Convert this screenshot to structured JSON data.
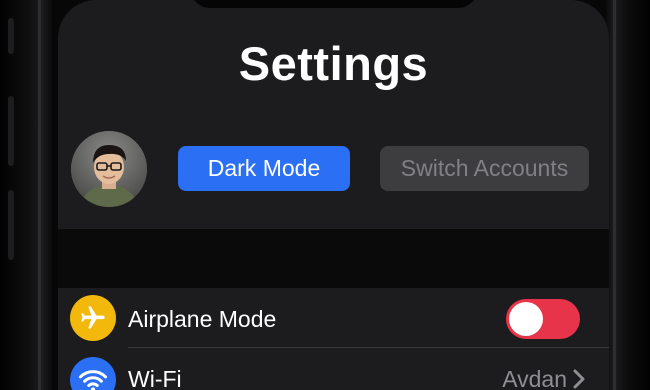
{
  "page": {
    "title": "Settings"
  },
  "profile": {
    "dark_mode_button": "Dark Mode",
    "switch_accounts_button": "Switch Accounts"
  },
  "settings": {
    "items": [
      {
        "label": "Airplane Mode",
        "icon": "airplane-icon",
        "icon_color": "#f2b90c",
        "control": "toggle",
        "toggle_on": true
      },
      {
        "label": "Wi-Fi",
        "icon": "wifi-icon",
        "icon_color": "#2b6ff4",
        "control": "disclosure",
        "detail": "Avdan"
      }
    ]
  },
  "colors": {
    "accent": "#2b6ff4",
    "toggle_on": "#e8344a",
    "background": "#1c1c1e",
    "airplane": "#f2b90c"
  }
}
